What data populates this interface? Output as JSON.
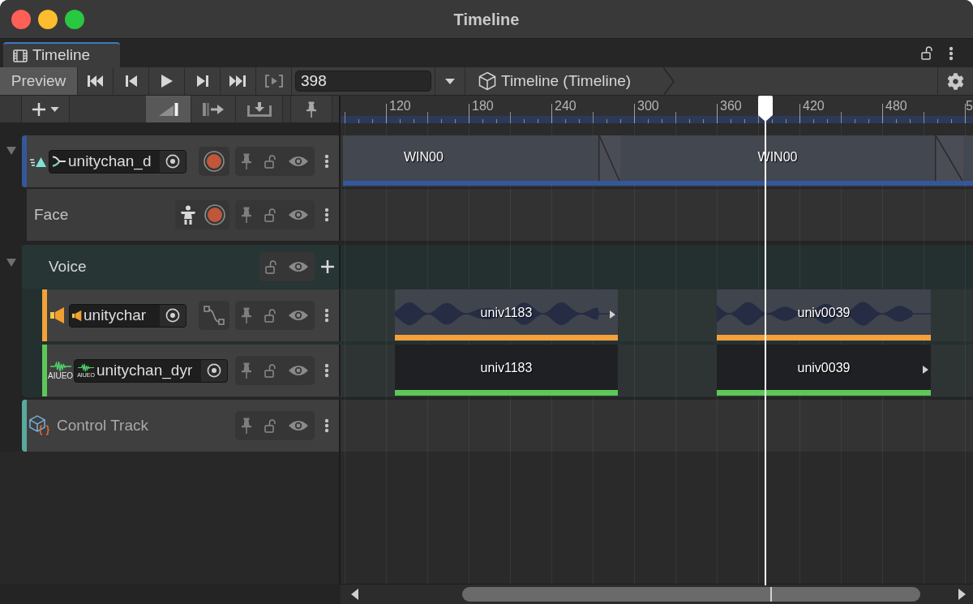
{
  "window": {
    "title": "Timeline"
  },
  "tabs": [
    {
      "label": "Timeline",
      "selected": true
    }
  ],
  "toolbar": {
    "preview": "Preview",
    "frame": "398",
    "breadcrumb": "Timeline (Timeline)"
  },
  "edit_modes": [
    {
      "kind": "mix",
      "selected": true
    },
    {
      "kind": "ripple",
      "selected": false
    },
    {
      "kind": "replace",
      "selected": false
    }
  ],
  "ruler": {
    "ticks": [
      "120",
      "180",
      "240",
      "300",
      "360",
      "420",
      "480",
      "5"
    ]
  },
  "tracks": [
    {
      "kind": "animation",
      "name": "unitychan_d",
      "color": "#33579a",
      "expanded": true,
      "clips": [
        {
          "kind": "clip",
          "label": "WIN00"
        },
        {
          "kind": "blend"
        },
        {
          "kind": "clip",
          "label": "WIN00"
        },
        {
          "kind": "blend"
        },
        {
          "kind": "clip"
        }
      ],
      "children": [
        {
          "kind": "override",
          "name": "Face"
        }
      ]
    },
    {
      "kind": "group",
      "name": "Voice",
      "expanded": true,
      "children": [
        {
          "kind": "audio",
          "name": "unitychar",
          "color": "#f2a23a",
          "clips": [
            {
              "label": "univ1183",
              "continues": true
            },
            {
              "label": "univ0039",
              "continues": false
            }
          ]
        },
        {
          "kind": "lipsync",
          "name": "unitychan_dyr",
          "color": "#5dc858",
          "icon_caption": "AIUEO",
          "field_icon_caption": "AIUEO",
          "clips": [
            {
              "label": "univ1183",
              "continues": false
            },
            {
              "label": "univ0039",
              "continues": true
            }
          ]
        }
      ]
    },
    {
      "kind": "control",
      "name": "Control Track",
      "color": "#58aa9c"
    }
  ]
}
